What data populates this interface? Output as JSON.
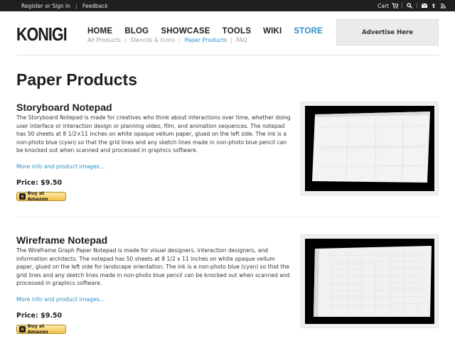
{
  "topbar": {
    "register_label": "Register or Sign In",
    "feedback_label": "Feedback",
    "cart_label": "Cart"
  },
  "header": {
    "logo": "KONIGI",
    "nav": [
      "HOME",
      "BLOG",
      "SHOWCASE",
      "TOOLS",
      "WIKI",
      "STORE"
    ],
    "active_nav": "STORE",
    "subnav": [
      "All Products",
      "Stencils & Icons",
      "Paper Products",
      "FAQ"
    ],
    "active_subnav": "Paper Products",
    "advert": "Advertise Here"
  },
  "page": {
    "title": "Paper Products"
  },
  "products": [
    {
      "title": "Storyboard Notepad",
      "description": "The Storyboard Notepad is made for creatives who think about interactions over time, whether doing user interface or interaction design or planning video, film, and animation sequences. The notepad has 50 sheets at 8 1/2×11 inches on white opaque vellum paper, glued on the left side. The ink is a non-photo blue (cyan) so that the grid lines and any sketch lines made in non-photo blue pencil can be knocked out when scanned and processed in graphics software.",
      "more_link": "More info and product images...",
      "price": "Price: $9.50",
      "buy_label": "Buy at Amazon"
    },
    {
      "title": "Wireframe Notepad",
      "description": "The Wireframe Graph Paper Notepad is made for visual designers, interaction designers, and information architects. The notepad has 50 sheets at 8 1/2 x 11 inches on white opaque vellum paper, glued on the left side for landscape orientation. The ink is a non-photo blue (cyan) so that the grid lines and any sketch lines made in non-photo blue pencil can be knocked out when scanned and processed in graphics software.",
      "more_link": "More info and product images...",
      "price": "Price: $9.50",
      "buy_label": "Buy at Amazon"
    }
  ],
  "colors": {
    "accent": "#2a8fc7",
    "topbar_bg": "#1f1f1f"
  }
}
